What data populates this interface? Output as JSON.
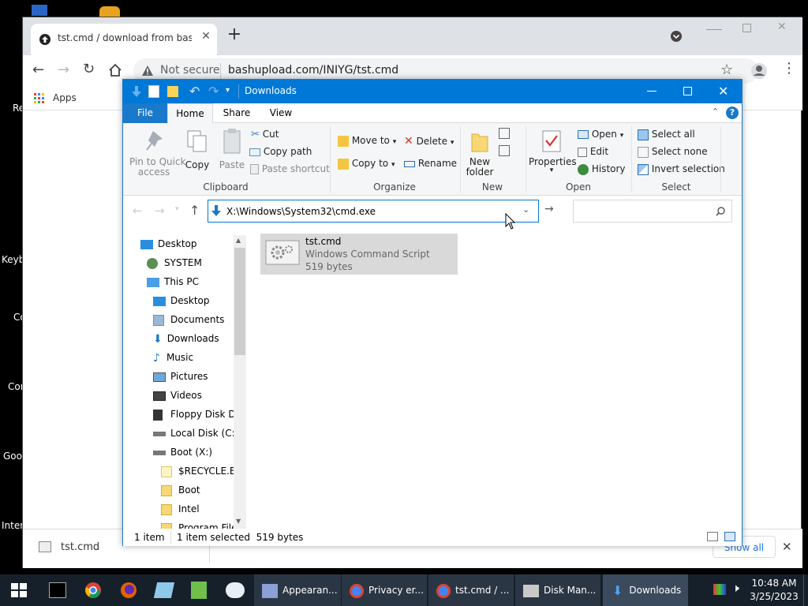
{
  "desktop": {
    "labels": [
      "Re",
      "Keyb",
      "Co",
      "Cor",
      "Goo",
      "Inter"
    ]
  },
  "chrome": {
    "tab_title": "tst.cmd / download from bashupload",
    "not_secure": "Not secure",
    "url": "bashupload.com/INIYG/tst.cmd",
    "bookmarks_apps": "Apps",
    "download_file": "tst.cmd",
    "show_all": "Show all"
  },
  "explorer": {
    "title": "Downloads",
    "tabs": {
      "file": "File",
      "home": "Home",
      "share": "Share",
      "view": "View"
    },
    "ribbon": {
      "pin": "Pin to Quick access",
      "pin_l1": "Pin to Quick",
      "pin_l2": "access",
      "copy": "Copy",
      "paste": "Paste",
      "cut": "Cut",
      "copy_path": "Copy path",
      "paste_shortcut": "Paste shortcut",
      "clipboard": "Clipboard",
      "move_to": "Move to",
      "copy_to": "Copy to",
      "delete": "Delete",
      "rename": "Rename",
      "organize": "Organize",
      "new_folder_l1": "New",
      "new_folder_l2": "folder",
      "new": "New",
      "properties": "Properties",
      "open_btn": "Open",
      "edit": "Edit",
      "history": "History",
      "open": "Open",
      "select_all": "Select all",
      "select_none": "Select none",
      "invert_selection": "Invert selection",
      "select": "Select"
    },
    "address": "X:\\Windows\\System32\\cmd.exe",
    "tree": [
      {
        "label": "Desktop",
        "icon": "desktop-icon"
      },
      {
        "label": "SYSTEM",
        "icon": "user-icon"
      },
      {
        "label": "This PC",
        "icon": "pc-icon"
      },
      {
        "label": "Desktop",
        "icon": "desktop-icon"
      },
      {
        "label": "Documents",
        "icon": "documents-icon"
      },
      {
        "label": "Downloads",
        "icon": "downloads-icon"
      },
      {
        "label": "Music",
        "icon": "music-icon"
      },
      {
        "label": "Pictures",
        "icon": "pictures-icon"
      },
      {
        "label": "Videos",
        "icon": "videos-icon"
      },
      {
        "label": "Floppy Disk Dri",
        "icon": "floppy-icon"
      },
      {
        "label": "Local Disk (C:)",
        "icon": "drive-icon"
      },
      {
        "label": "Boot (X:)",
        "icon": "drive-icon"
      },
      {
        "label": "$RECYCLE.BIN",
        "icon": "folder-icon"
      },
      {
        "label": "Boot",
        "icon": "folder-icon"
      },
      {
        "label": "Intel",
        "icon": "folder-icon"
      },
      {
        "label": "Program Files",
        "icon": "folder-icon"
      }
    ],
    "file": {
      "name": "tst.cmd",
      "type": "Windows Command Script",
      "size": "519 bytes"
    },
    "status": {
      "count": "1 item",
      "selected": "1 item selected  519 bytes"
    }
  },
  "taskbar": {
    "items": [
      {
        "label": "Appearan..."
      },
      {
        "label": "Privacy er..."
      },
      {
        "label": "tst.cmd / ..."
      },
      {
        "label": "Disk Man..."
      },
      {
        "label": "Downloads"
      }
    ],
    "time": "10:48 AM",
    "date": "3/25/2023"
  },
  "colors": {
    "accent": "#0078d7",
    "taskbar": "#15202b"
  }
}
